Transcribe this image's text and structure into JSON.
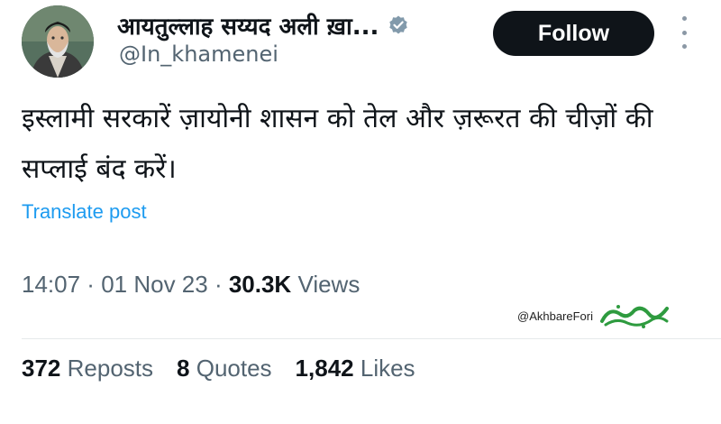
{
  "author": {
    "display_name": "आयतुल्लाह सय्यद अली ख़ा...",
    "handle": "@In_khamenei"
  },
  "follow_label": "Follow",
  "tweet": {
    "text": "इस्लामी सरकारें ज़ायोनी शासन को तेल और ज़रूरत की चीज़ों की सप्लाई बंद करें।",
    "translate_label": "Translate post"
  },
  "meta": {
    "time": "14:07",
    "sep1": " · ",
    "date": "01 Nov 23",
    "sep2": " · ",
    "views_count": "30.3K",
    "views_label": " Views"
  },
  "watermark": {
    "handle": "@AkhbareFori"
  },
  "stats": {
    "reposts_count": "372",
    "reposts_label": "Reposts",
    "quotes_count": "8",
    "quotes_label": "Quotes",
    "likes_count": "1,842",
    "likes_label": "Likes"
  },
  "icons": {
    "verified": "verified-badge-icon",
    "more": "more-options-icon"
  },
  "colors": {
    "accent": "#1d9bf0",
    "follow_bg": "#0f1419",
    "muted": "#536471",
    "logo_green": "#2e9b3f"
  }
}
